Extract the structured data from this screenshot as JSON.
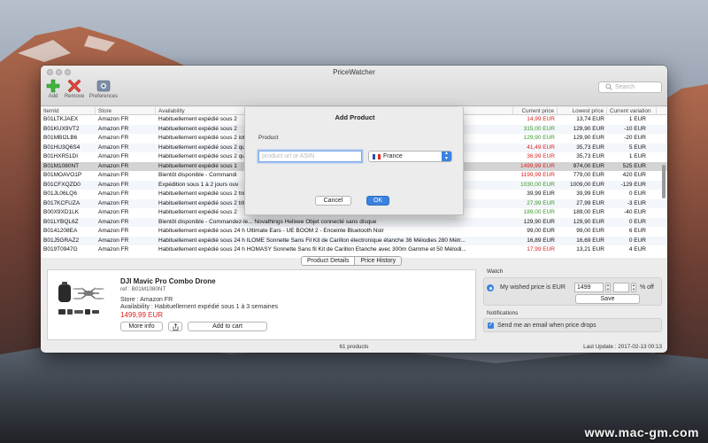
{
  "window": {
    "title": "PriceWatcher"
  },
  "toolbar": {
    "add_label": "Add",
    "remove_label": "Remove",
    "preferences_label": "Preferences",
    "search_placeholder": "Search"
  },
  "table": {
    "columns": [
      "ItemId",
      "Store",
      "Availability",
      "Current price",
      "Lowest price",
      "Current variation"
    ],
    "rows": [
      {
        "id": "B01LTKJAEX",
        "store": "Amazon FR",
        "availability": "Habituellement expédié sous 2",
        "current": "14,99 EUR",
        "current_color": "red",
        "lowest": "13,74 EUR",
        "variation": "1 EUR",
        "selected": false
      },
      {
        "id": "B01KUX9VT2",
        "store": "Amazon FR",
        "availability": "Habituellement expédié sous 2",
        "current": "315,00 EUR",
        "current_color": "green",
        "lowest": "129,90 EUR",
        "variation": "-10 EUR",
        "selected": false
      },
      {
        "id": "B01MBI2LB6",
        "store": "Amazon FR",
        "availability": "Habituellement expédié sous 2                                                                                   iote)",
        "current": "129,90 EUR",
        "current_color": "green",
        "lowest": "129,90 EUR",
        "variation": "-20 EUR",
        "selected": false
      },
      {
        "id": "B01HU3Q6S4",
        "store": "Amazon FR",
        "availability": "Habituellement expédié sous 2                                                                                   qu'à 90 Mo/...",
        "current": "41,49 EUR",
        "current_color": "red",
        "lowest": "35,73 EUR",
        "variation": "5 EUR",
        "selected": false
      },
      {
        "id": "B01HXR51DI",
        "store": "Amazon FR",
        "availability": "Habituellement expédié sous 2                                                                                   qu'à 90 Mo/...",
        "current": "36,99 EUR",
        "current_color": "red",
        "lowest": "35,73 EUR",
        "variation": "1 EUR",
        "selected": false
      },
      {
        "id": "B01M1080NT",
        "store": "Amazon FR",
        "availability": "Habituellement expédié sous 1",
        "current": "1499,99 EUR",
        "current_color": "red",
        "lowest": "974,00 EUR",
        "variation": "525 EUR",
        "selected": true
      },
      {
        "id": "B01MOAVO1P",
        "store": "Amazon FR",
        "availability": "Bientôt disponible - Commandi",
        "current": "1199,99 EUR",
        "current_color": "red",
        "lowest": "779,00 EUR",
        "variation": "420 EUR",
        "selected": false
      },
      {
        "id": "B01CFXQZD0",
        "store": "Amazon FR",
        "availability": "Expédition sous 1 à 2 jours ouv",
        "current": "1030,00 EUR",
        "current_color": "green",
        "lowest": "1009,00 EUR",
        "variation": "-129 EUR",
        "selected": false
      },
      {
        "id": "B01JL06LQ6",
        "store": "Amazon FR",
        "availability": "Habituellement expédié sous 2                                                                                   tning 5V/ 2A...",
        "current": "39,99 EUR",
        "current_color": "black",
        "lowest": "39,99 EUR",
        "variation": "0 EUR",
        "selected": false
      },
      {
        "id": "B017KCFUZA",
        "store": "Amazon FR",
        "availability": "Habituellement expédié sous 2                                                                                   trite avec la T...",
        "current": "27,99 EUR",
        "current_color": "green",
        "lowest": "27,99 EUR",
        "variation": "-3 EUR",
        "selected": false
      },
      {
        "id": "B00X9XD1LK",
        "store": "Amazon FR",
        "availability": "Habituellement expédié sous 2",
        "current": "189,00 EUR",
        "current_color": "green",
        "lowest": "189,00 EUR",
        "variation": "-40 EUR",
        "selected": false
      },
      {
        "id": "B01LYBQL6Z",
        "store": "Amazon FR",
        "availability": "Bientôt disponible - Commandez-le...    Novathings Helixee Objet connecté sans disque",
        "current": "129,90 EUR",
        "current_color": "black",
        "lowest": "129,90 EUR",
        "variation": "0 EUR",
        "selected": false
      },
      {
        "id": "B0141208EA",
        "store": "Amazon FR",
        "availability": "Habituellement expédié sous 24 h        Ultimate Ears - UE BOOM 2 - Enceinte Bluetooth Noir",
        "current": "99,00 EUR",
        "current_color": "black",
        "lowest": "99,00 EUR",
        "variation": "6 EUR",
        "selected": false
      },
      {
        "id": "B01J5GRAZ2",
        "store": "Amazon FR",
        "availability": "Habituellement expédié sous 24 h        ILOME Sonnette Sans Fil Kit de Carillon électronique étanche 36 Mélodies 280 Mètr...",
        "current": "16,89 EUR",
        "current_color": "black",
        "lowest": "16,69 EUR",
        "variation": "0 EUR",
        "selected": false
      },
      {
        "id": "B019T0947G",
        "store": "Amazon FR",
        "availability": "Habituellement expédié sous 24 h        HOMASY Sonnette Sans fil Kit de Carillon Etanche avec 300m Gamme et 50 Mélodi...",
        "current": "17,99 EUR",
        "current_color": "red",
        "lowest": "13,21 EUR",
        "variation": "4 EUR",
        "selected": false
      }
    ]
  },
  "tabs": {
    "product_details": "Product Details",
    "price_history": "Price History"
  },
  "product": {
    "name": "DJI Mavic Pro Combo Drone",
    "ref": "ref : B01M1080NT",
    "store": "Store : Amazon FR",
    "availability": "Availability : Habituellement expédié sous 1 à 3 semaines",
    "price": "1499,99 EUR",
    "more_info_label": "More info",
    "add_to_cart_label": "Add to cart"
  },
  "watch": {
    "section_label": "Watch",
    "wished_label": "My wished price is EUR",
    "wished_value": "1499",
    "percent_label": "% off",
    "save_label": "Save"
  },
  "notifications": {
    "section_label": "Notifications",
    "email_label": "Send me an email when price drops"
  },
  "status": {
    "count": "61 products",
    "last_update": "Last Update : 2017-02-13 00:13"
  },
  "dialog": {
    "title": "Add Product",
    "product_label": "Product",
    "input_placeholder": "product url or ASIN",
    "country": "France",
    "cancel_label": "Cancel",
    "ok_label": "OK"
  },
  "watermark": "www.mac-gm.com",
  "colors": {
    "accent": "#3b82e0",
    "price_up": "#dd2222",
    "price_down": "#3a9a2a"
  }
}
